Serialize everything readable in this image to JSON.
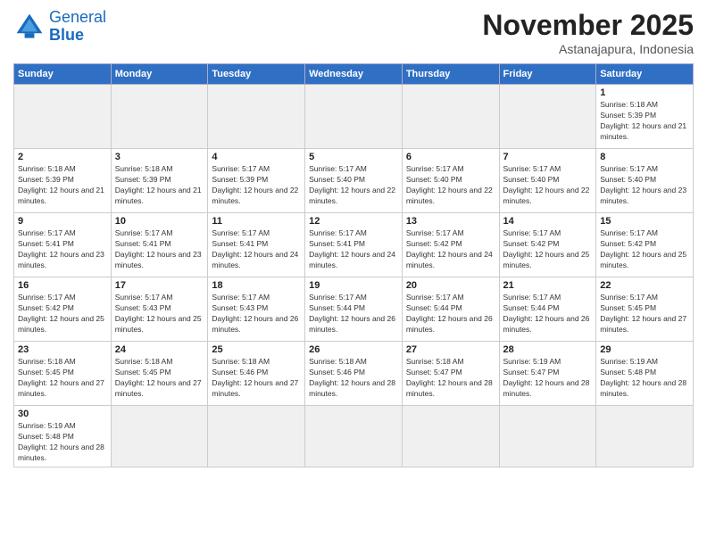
{
  "header": {
    "logo_general": "General",
    "logo_blue": "Blue",
    "month_title": "November 2025",
    "subtitle": "Astanajapura, Indonesia"
  },
  "weekdays": [
    "Sunday",
    "Monday",
    "Tuesday",
    "Wednesday",
    "Thursday",
    "Friday",
    "Saturday"
  ],
  "days": {
    "1": {
      "sunrise": "5:18 AM",
      "sunset": "5:39 PM",
      "daylight": "12 hours and 21 minutes."
    },
    "2": {
      "sunrise": "5:18 AM",
      "sunset": "5:39 PM",
      "daylight": "12 hours and 21 minutes."
    },
    "3": {
      "sunrise": "5:18 AM",
      "sunset": "5:39 PM",
      "daylight": "12 hours and 21 minutes."
    },
    "4": {
      "sunrise": "5:17 AM",
      "sunset": "5:39 PM",
      "daylight": "12 hours and 22 minutes."
    },
    "5": {
      "sunrise": "5:17 AM",
      "sunset": "5:40 PM",
      "daylight": "12 hours and 22 minutes."
    },
    "6": {
      "sunrise": "5:17 AM",
      "sunset": "5:40 PM",
      "daylight": "12 hours and 22 minutes."
    },
    "7": {
      "sunrise": "5:17 AM",
      "sunset": "5:40 PM",
      "daylight": "12 hours and 22 minutes."
    },
    "8": {
      "sunrise": "5:17 AM",
      "sunset": "5:40 PM",
      "daylight": "12 hours and 23 minutes."
    },
    "9": {
      "sunrise": "5:17 AM",
      "sunset": "5:41 PM",
      "daylight": "12 hours and 23 minutes."
    },
    "10": {
      "sunrise": "5:17 AM",
      "sunset": "5:41 PM",
      "daylight": "12 hours and 23 minutes."
    },
    "11": {
      "sunrise": "5:17 AM",
      "sunset": "5:41 PM",
      "daylight": "12 hours and 24 minutes."
    },
    "12": {
      "sunrise": "5:17 AM",
      "sunset": "5:41 PM",
      "daylight": "12 hours and 24 minutes."
    },
    "13": {
      "sunrise": "5:17 AM",
      "sunset": "5:42 PM",
      "daylight": "12 hours and 24 minutes."
    },
    "14": {
      "sunrise": "5:17 AM",
      "sunset": "5:42 PM",
      "daylight": "12 hours and 25 minutes."
    },
    "15": {
      "sunrise": "5:17 AM",
      "sunset": "5:42 PM",
      "daylight": "12 hours and 25 minutes."
    },
    "16": {
      "sunrise": "5:17 AM",
      "sunset": "5:42 PM",
      "daylight": "12 hours and 25 minutes."
    },
    "17": {
      "sunrise": "5:17 AM",
      "sunset": "5:43 PM",
      "daylight": "12 hours and 25 minutes."
    },
    "18": {
      "sunrise": "5:17 AM",
      "sunset": "5:43 PM",
      "daylight": "12 hours and 26 minutes."
    },
    "19": {
      "sunrise": "5:17 AM",
      "sunset": "5:44 PM",
      "daylight": "12 hours and 26 minutes."
    },
    "20": {
      "sunrise": "5:17 AM",
      "sunset": "5:44 PM",
      "daylight": "12 hours and 26 minutes."
    },
    "21": {
      "sunrise": "5:17 AM",
      "sunset": "5:44 PM",
      "daylight": "12 hours and 26 minutes."
    },
    "22": {
      "sunrise": "5:17 AM",
      "sunset": "5:45 PM",
      "daylight": "12 hours and 27 minutes."
    },
    "23": {
      "sunrise": "5:18 AM",
      "sunset": "5:45 PM",
      "daylight": "12 hours and 27 minutes."
    },
    "24": {
      "sunrise": "5:18 AM",
      "sunset": "5:45 PM",
      "daylight": "12 hours and 27 minutes."
    },
    "25": {
      "sunrise": "5:18 AM",
      "sunset": "5:46 PM",
      "daylight": "12 hours and 27 minutes."
    },
    "26": {
      "sunrise": "5:18 AM",
      "sunset": "5:46 PM",
      "daylight": "12 hours and 28 minutes."
    },
    "27": {
      "sunrise": "5:18 AM",
      "sunset": "5:47 PM",
      "daylight": "12 hours and 28 minutes."
    },
    "28": {
      "sunrise": "5:19 AM",
      "sunset": "5:47 PM",
      "daylight": "12 hours and 28 minutes."
    },
    "29": {
      "sunrise": "5:19 AM",
      "sunset": "5:48 PM",
      "daylight": "12 hours and 28 minutes."
    },
    "30": {
      "sunrise": "5:19 AM",
      "sunset": "5:48 PM",
      "daylight": "12 hours and 28 minutes."
    }
  }
}
